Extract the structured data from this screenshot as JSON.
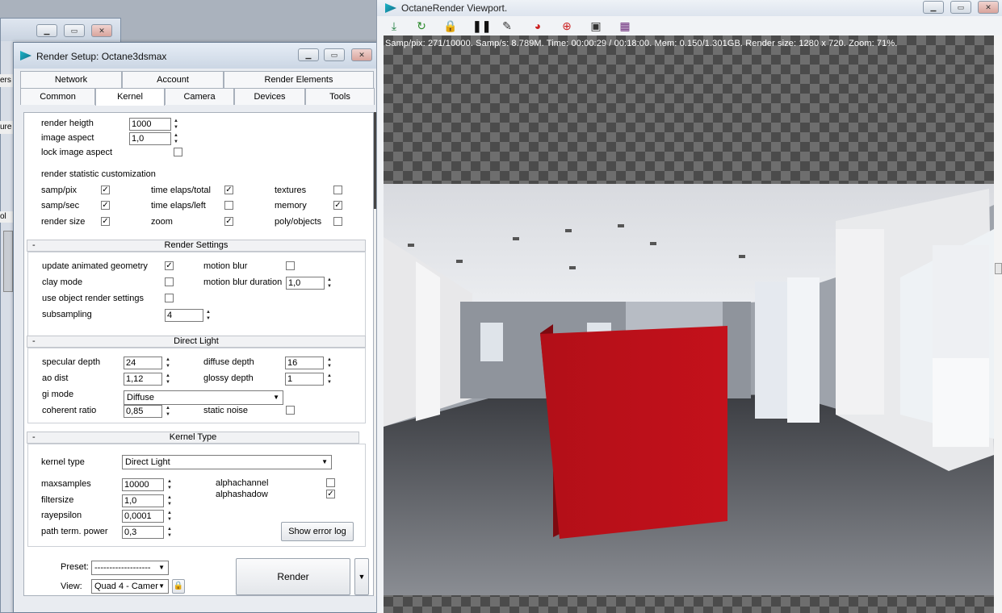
{
  "background_window": {
    "fragments": [
      "ers",
      "ure",
      "ol"
    ]
  },
  "render_setup": {
    "title": "Render Setup: Octane3dsmax",
    "tabs_row1": [
      "Network",
      "Account",
      "Render Elements"
    ],
    "tabs_row2": [
      "Common",
      "Kernel",
      "Camera",
      "Devices",
      "Tools"
    ],
    "active_tab": "Kernel",
    "image": {
      "render_height_label": "render heigth",
      "render_height_value": "1000",
      "image_aspect_label": "image aspect",
      "image_aspect_value": "1,0",
      "lock_aspect_label": "lock image aspect"
    },
    "stats_custom": {
      "heading": "render statistic customization",
      "items": [
        {
          "label": "samp/pix",
          "checked": true
        },
        {
          "label": "time elaps/total",
          "checked": true
        },
        {
          "label": "textures",
          "checked": false
        },
        {
          "label": "samp/sec",
          "checked": true
        },
        {
          "label": "time elaps/left",
          "checked": false
        },
        {
          "label": "memory",
          "checked": true
        },
        {
          "label": "render size",
          "checked": true
        },
        {
          "label": "zoom",
          "checked": true
        },
        {
          "label": "poly/objects",
          "checked": false
        }
      ]
    },
    "render_settings": {
      "title": "Render Settings",
      "minus": "-",
      "update_geom_label": "update animated geometry",
      "clay_mode_label": "clay mode",
      "use_obj_label": "use object render settings",
      "subsampling_label": "subsampling",
      "subsampling_value": "4",
      "motion_blur_label": "motion blur",
      "motion_blur_dur_label": "motion blur duration",
      "motion_blur_dur_value": "1,0"
    },
    "direct_light": {
      "title": "Direct Light",
      "minus": "-",
      "specular_depth_label": "specular depth",
      "specular_depth_value": "24",
      "ao_dist_label": "ao dist",
      "ao_dist_value": "1,12",
      "gi_mode_label": "gi mode",
      "gi_mode_value": "Diffuse",
      "coherent_ratio_label": "coherent ratio",
      "coherent_ratio_value": "0,85",
      "diffuse_depth_label": "diffuse depth",
      "diffuse_depth_value": "16",
      "glossy_depth_label": "glossy depth",
      "glossy_depth_value": "1",
      "static_noise_label": "static noise"
    },
    "kernel_type": {
      "title": "Kernel Type",
      "minus": "-",
      "kernel_type_label": "kernel type",
      "kernel_type_value": "Direct Light",
      "maxsamples_label": "maxsamples",
      "maxsamples_value": "10000",
      "filtersize_label": "filtersize",
      "filtersize_value": "1,0",
      "rayepsilon_label": "rayepsilon",
      "rayepsilon_value": "0,0001",
      "path_term_label": "path term. power",
      "path_term_value": "0,3",
      "alphachannel_label": "alphachannel",
      "alphashadow_label": "alphashadow",
      "show_error_log": "Show error log"
    },
    "footer": {
      "preset_label": "Preset:",
      "preset_value": "-------------------",
      "view_label": "View:",
      "view_value": "Quad 4 - Camer",
      "render_button": "Render"
    }
  },
  "octane_viewport": {
    "title": "OctaneRender Viewport.",
    "stats": "Samp/pix: 271/10000.   Samp/s: 8.789M.   Time: 00:00:29 / 00:18:00.   Mem: 0.150/1.301GB.   Render size: 1280 x 720.   Zoom: 71%.",
    "toolbar_icons": [
      "save-icon",
      "refresh-icon",
      "lock-icon",
      "pause-icon",
      "focus-picker-icon",
      "color-picker-icon",
      "material-picker-icon",
      "monitor-icon",
      "region-icon"
    ]
  },
  "colors": {
    "cube_red": "#c4111b",
    "title_bar": "#d6dfeb",
    "check_bg": "#4b4b4b"
  }
}
